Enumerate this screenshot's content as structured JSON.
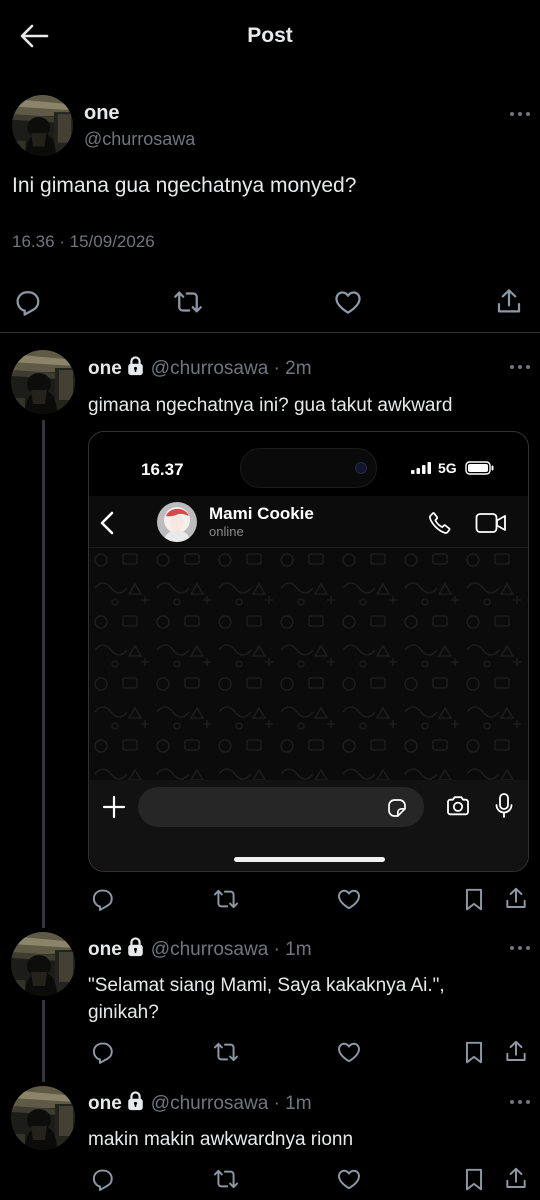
{
  "header": {
    "title": "Post"
  },
  "main_post": {
    "name": "one",
    "handle": "@churrosawa",
    "text": "Ini gimana gua ngechatnya monyed?",
    "timestamp": "16.36 · 15/09/2026"
  },
  "replies": [
    {
      "name": "one",
      "handle": "@churrosawa",
      "time": "· 2m",
      "text": "gimana ngechatnya ini? gua takut awkward"
    },
    {
      "name": "one",
      "handle": "@churrosawa",
      "time": "· 1m",
      "text": "\"Selamat siang Mami, Saya kakaknya Ai.\", ginikah?"
    },
    {
      "name": "one",
      "handle": "@churrosawa",
      "time": "· 1m",
      "text": "makin makin awkwardnya rionn"
    }
  ],
  "embed": {
    "status_time": "16.37",
    "network": "5G",
    "contact_name": "Mami Cookie",
    "contact_status": "online"
  },
  "colors": {
    "background": "#000000",
    "text": "#e7e9ea",
    "secondary": "#71767b",
    "divider": "#2f3336"
  },
  "icons": [
    "back-arrow-icon",
    "more-icon",
    "reply-icon",
    "repost-icon",
    "like-icon",
    "bookmark-icon",
    "share-icon",
    "lock-icon",
    "phone-icon",
    "video-icon",
    "plus-icon",
    "sticker-icon",
    "camera-icon",
    "mic-icon"
  ]
}
